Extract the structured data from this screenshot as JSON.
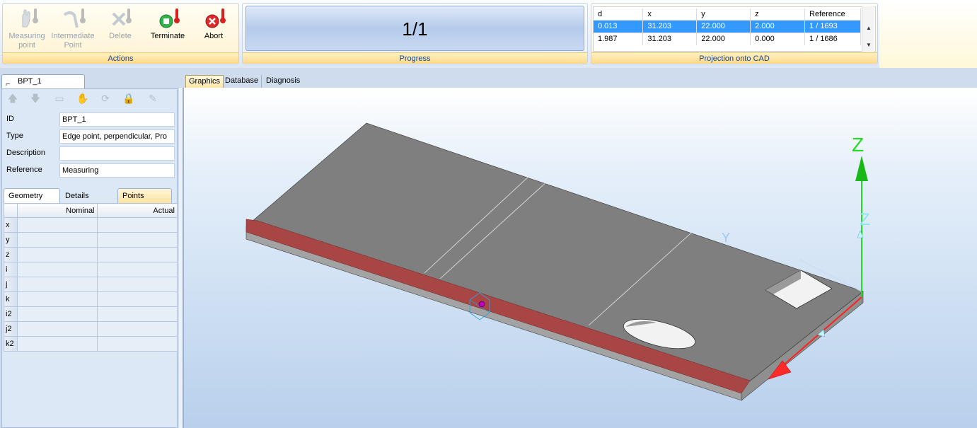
{
  "actions": {
    "group_label": "Actions",
    "buttons": [
      {
        "label": "Measuring point",
        "enabled": false
      },
      {
        "label": "Intermediate Point",
        "enabled": false
      },
      {
        "label": "Delete",
        "enabled": false
      },
      {
        "label": "Terminate",
        "enabled": true
      },
      {
        "label": "Abort",
        "enabled": true
      }
    ]
  },
  "progress": {
    "value": "1/1",
    "group_label": "Progress"
  },
  "projection": {
    "group_label": "Projection onto CAD",
    "columns": [
      "d",
      "x",
      "y",
      "z",
      "Reference"
    ],
    "rows": [
      [
        "0.013",
        "31.203",
        "22.000",
        "2.000",
        "1 / 1693"
      ],
      [
        "1.987",
        "31.203",
        "22.000",
        "0.000",
        "1 / 1686"
      ]
    ],
    "selected_row": 0
  },
  "element": {
    "tab_label": "BPT_1",
    "toolbar_icons": [
      "arrow-up-icon",
      "arrow-down-icon",
      "open-folder-icon",
      "hand-probe-icon",
      "refresh-icon",
      "lock-icon",
      "edit-pencil-icon"
    ],
    "fields": [
      {
        "label": "ID",
        "value": "BPT_1"
      },
      {
        "label": "Type",
        "value": "Edge point, perpendicular, Pro"
      },
      {
        "label": "Description",
        "value": ""
      },
      {
        "label": "Reference",
        "value": "Measuring"
      }
    ]
  },
  "detail_tabs": [
    "Geometry",
    "Details",
    "Points"
  ],
  "geometry": {
    "columns": [
      "Nominal",
      "Actual"
    ],
    "rows": [
      "x",
      "y",
      "z",
      "i",
      "j",
      "k",
      "i2",
      "j2",
      "k2"
    ]
  },
  "view_tabs": [
    "Graphics",
    "Database",
    "Diagnosis"
  ],
  "viewport": {
    "axis_labels": {
      "z_main": "Z",
      "z_secondary": "Z",
      "y_faded": "Y"
    },
    "colors": {
      "part_top": "#7f7f7f",
      "part_side": "#a2a2a2",
      "edge_highlight": "#a84646",
      "axis_z": "#20e020",
      "axis_x": "#ff2020",
      "probe": "#c000c0"
    }
  }
}
